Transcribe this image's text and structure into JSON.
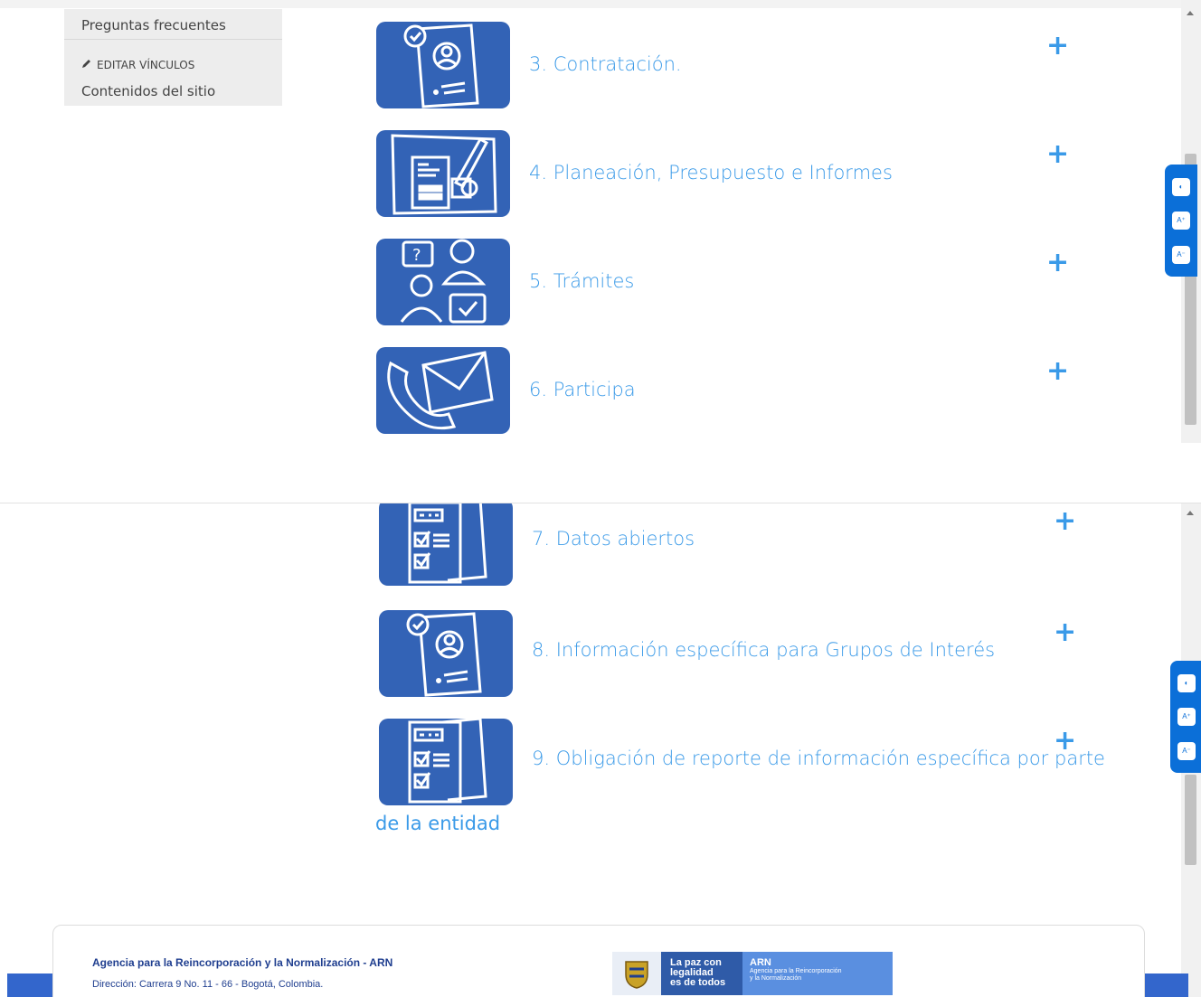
{
  "sidebar": {
    "faq": "Preguntas frecuentes",
    "edit_links": "EDITAR VÍNCULOS",
    "site_contents": "Contenidos del sitio"
  },
  "items": [
    {
      "label": "3. Contratación.",
      "icon": "contract-icon"
    },
    {
      "label": "4. Planeación, Presupuesto e Informes",
      "icon": "planning-icon"
    },
    {
      "label": "5. Trámites",
      "icon": "procedures-icon"
    },
    {
      "label": "6. Participa",
      "icon": "participate-icon"
    },
    {
      "label": "7. Datos abiertos",
      "icon": "open-data-icon"
    },
    {
      "label": "8. Información específica para Grupos de Interés",
      "icon": "interest-groups-icon"
    },
    {
      "label": "9. Obligación de reporte de información específica por parte",
      "continuation": "de la entidad",
      "icon": "reporting-icon"
    }
  ],
  "expand_symbol": "+",
  "accessibility": {
    "contrast": "◐",
    "font_up": "A⁺",
    "font_down": "A⁻"
  },
  "footer": {
    "org": "Agencia para la Reincorporación y la Normalización - ARN",
    "address": "Dirección: Carrera 9 No. 11 - 66 - Bogotá, Colombia.",
    "logo_slogan": [
      "La paz con",
      "legalidad",
      "es de todos"
    ],
    "logo_arn": "ARN",
    "logo_arn_sub": [
      "Agencia para la Reincorporación",
      "y la Normalización"
    ]
  },
  "colors": {
    "tile": "#3363b6",
    "link": "#3a9ae8",
    "a11y": "#0b6fd8",
    "footer_text": "#1f3e8f"
  }
}
